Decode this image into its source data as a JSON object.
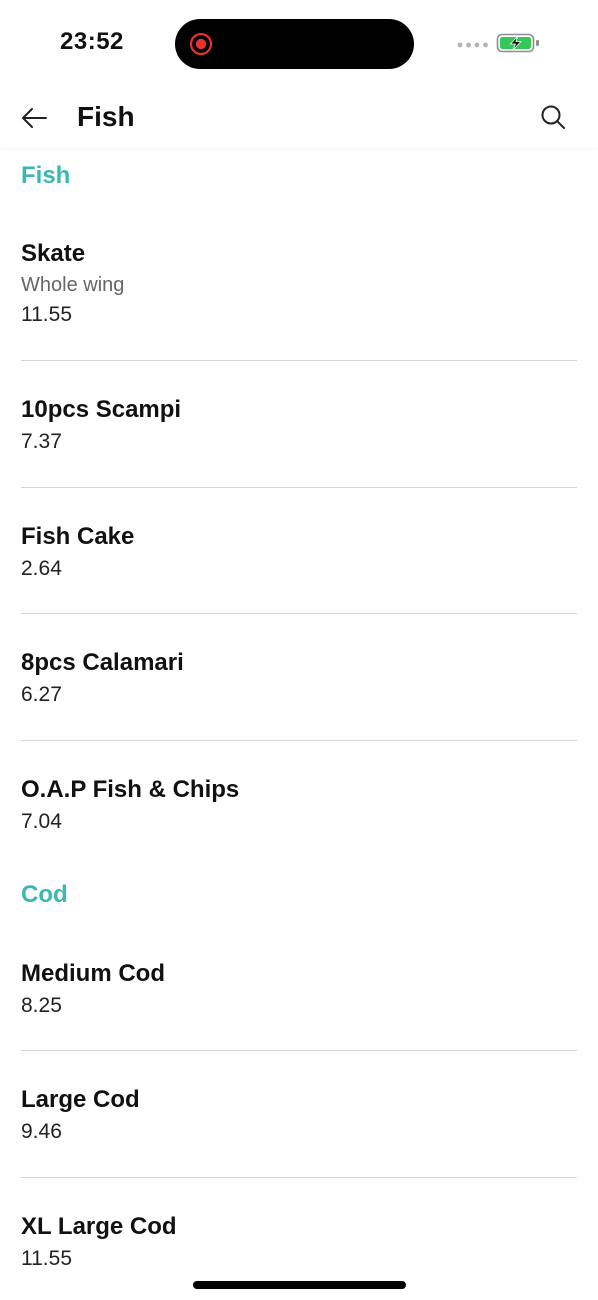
{
  "status_bar": {
    "time": "23:52",
    "record_color": "#e8322b",
    "battery_color": "#34c759"
  },
  "header": {
    "title": "Fish",
    "back_icon": "arrow-left-icon",
    "search_icon": "search-icon"
  },
  "colors": {
    "accent": "#3bb7b4"
  },
  "sections": [
    {
      "title": "Fish",
      "items": [
        {
          "name": "Skate",
          "description": "Whole wing",
          "price": "11.55"
        },
        {
          "name": "10pcs Scampi",
          "price": "7.37"
        },
        {
          "name": "Fish Cake",
          "price": "2.64"
        },
        {
          "name": "8pcs Calamari",
          "price": "6.27"
        },
        {
          "name": "O.A.P Fish & Chips",
          "price": "7.04"
        }
      ]
    },
    {
      "title": "Cod",
      "items": [
        {
          "name": "Medium Cod",
          "price": "8.25"
        },
        {
          "name": "Large Cod",
          "price": "9.46"
        },
        {
          "name": "XL Large Cod",
          "price": "11.55"
        }
      ]
    }
  ]
}
